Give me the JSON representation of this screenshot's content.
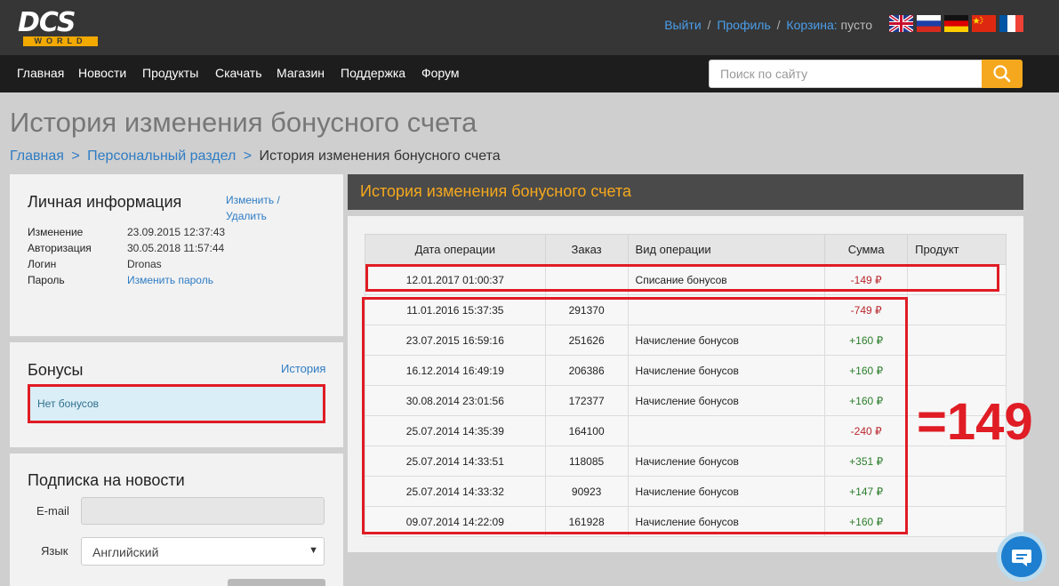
{
  "header": {
    "logo_main": "DCS",
    "logo_sub": "WORLD",
    "links": {
      "logout": "Выйти",
      "profile": "Профиль",
      "cart": "Корзина:",
      "cart_status": "пусто",
      "separator": "/"
    },
    "flags": [
      "flag-uk-icon",
      "flag-russia-icon",
      "flag-germany-icon",
      "flag-china-icon",
      "flag-france-icon"
    ]
  },
  "nav": {
    "items": [
      "Главная",
      "Новости",
      "Продукты",
      "Скачать",
      "Магазин",
      "Поддержка",
      "Форум"
    ],
    "search_placeholder": "Поиск по сайту"
  },
  "page": {
    "title": "История изменения бонусного счета",
    "breadcrumb": [
      "Главная",
      "Персональный раздел",
      "История изменения бонусного счета"
    ],
    "breadcrumb_sep": ">"
  },
  "personal": {
    "title": "Личная информация",
    "edit_link": "Изменить /",
    "delete_link": "Удалить",
    "rows": [
      {
        "label": "Изменение",
        "value": "23.09.2015 12:37:43"
      },
      {
        "label": "Авторизация",
        "value": "30.05.2018 11:57:44"
      },
      {
        "label": "Логин",
        "value": "Dronas"
      },
      {
        "label": "Пароль",
        "value": "Изменить пароль"
      }
    ]
  },
  "bonus": {
    "title": "Бонусы",
    "history_link": "История",
    "status": "Нет бонусов"
  },
  "subscribe": {
    "title": "Подписка на новости",
    "email_label": "E-mail",
    "email_value": "",
    "lang_label": "Язык",
    "lang_value": "Английский"
  },
  "history": {
    "title": "История изменения бонусного счета",
    "columns": [
      "Дата операции",
      "Заказ",
      "Вид операции",
      "Сумма",
      "Продукт"
    ],
    "rows": [
      {
        "date": "12.01.2017 01:00:37",
        "order": "",
        "type": "Списание бонусов",
        "amount": "-149 ₽",
        "product": "",
        "sign": "neg"
      },
      {
        "date": "11.01.2016 15:37:35",
        "order": "291370",
        "type": "",
        "amount": "-749 ₽",
        "product": "",
        "sign": "neg"
      },
      {
        "date": "23.07.2015 16:59:16",
        "order": "251626",
        "type": "Начисление бонусов",
        "amount": "+160 ₽",
        "product": "",
        "sign": "pos"
      },
      {
        "date": "16.12.2014 16:49:19",
        "order": "206386",
        "type": "Начисление бонусов",
        "amount": "+160 ₽",
        "product": "",
        "sign": "pos"
      },
      {
        "date": "30.08.2014 23:01:56",
        "order": "172377",
        "type": "Начисление бонусов",
        "amount": "+160 ₽",
        "product": "",
        "sign": "pos"
      },
      {
        "date": "25.07.2014 14:35:39",
        "order": "164100",
        "type": "",
        "amount": "-240 ₽",
        "product": "",
        "sign": "neg"
      },
      {
        "date": "25.07.2014 14:33:51",
        "order": "118085",
        "type": "Начисление бонусов",
        "amount": "+351 ₽",
        "product": "",
        "sign": "pos"
      },
      {
        "date": "25.07.2014 14:33:32",
        "order": "90923",
        "type": "Начисление бонусов",
        "amount": "+147 ₽",
        "product": "",
        "sign": "pos"
      },
      {
        "date": "09.07.2014 14:22:09",
        "order": "161928",
        "type": "Начисление бонусов",
        "amount": "+160 ₽",
        "product": "",
        "sign": "pos"
      }
    ]
  },
  "annotation": {
    "text": "=149",
    "color": "#e01c24"
  },
  "colors": {
    "accent": "#f5a81d",
    "link": "#2e7cc4",
    "negative": "#b8272d",
    "positive": "#2b7d2b"
  }
}
